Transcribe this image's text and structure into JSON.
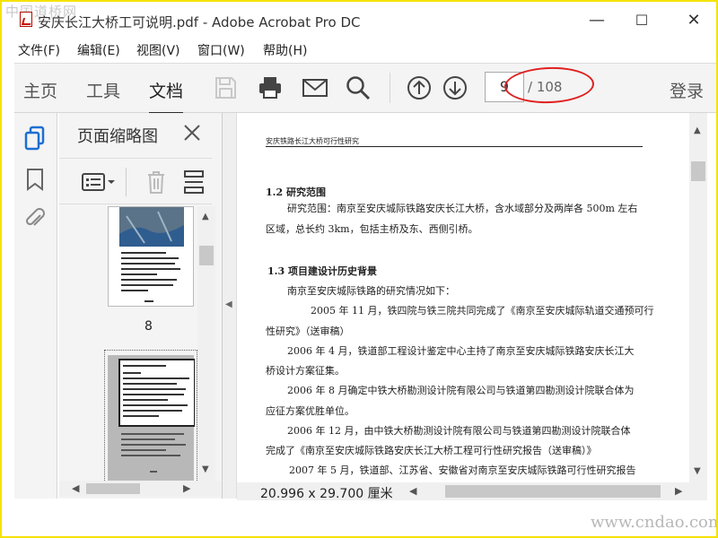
{
  "window": {
    "title": "安庆长江大桥工可说明.pdf - Adobe Acrobat Pro DC",
    "watermark_top": "中国道桥网",
    "minimize": "—",
    "maximize": "☐",
    "close": "✕"
  },
  "menu": [
    "文件(F)",
    "编辑(E)",
    "视图(V)",
    "窗口(W)",
    "帮助(H)"
  ],
  "toolbar": {
    "tabs": [
      "主页",
      "工具",
      "文档"
    ],
    "active_tab": "文档",
    "current_page": "9",
    "page_total": "/ 108",
    "login": "登录"
  },
  "sidebar": {
    "panel_title": "页面缩略图",
    "thumb_page_label": "8"
  },
  "document": {
    "header": "安庆铁路长江大桥可行性研究",
    "lines": [
      "1.2 研究范围",
      "研究范围：南京至安庆城际铁路安庆长江大桥，含水域部分及两岸各 500m 左右",
      "区域，总长约 3km，包括主桥及东、西侧引桥。",
      "1.3 项目建设计历史背景",
      "南京至安庆城际铁路的研究情况如下：",
      "2005 年 11 月，铁四院与铁三院共同完成了《南京至安庆城际轨道交通预可行",
      "性研究》（送审稿）",
      "2006 年 4 月，铁道部工程设计鉴定中心主持了南京至安庆城际铁路安庆长江大",
      "桥设计方案征集。",
      "2006 年 8 月确定中铁大桥勘测设计院有限公司与铁道第四勘测设计院联合体为",
      "应征方案优胜单位。",
      "2006 年 12 月，由中铁大桥勘测设计院有限公司与铁道第四勘测设计院联合体",
      "完成了《南京至安庆城际铁路安庆长江大桥工程可行性研究报告（送审稿）》",
      "2007 年 5 月，铁道部、江苏省、安徽省对南京至安庆城际铁路可行性研究报告"
    ],
    "page_size": "20.996 x 29.700 厘米"
  },
  "watermark_bottom": "www.cndao.com",
  "colors": {
    "frame_border": "#f5e200",
    "annotation_red": "#e02020",
    "toolbar_bg": "#f4f4f4"
  }
}
